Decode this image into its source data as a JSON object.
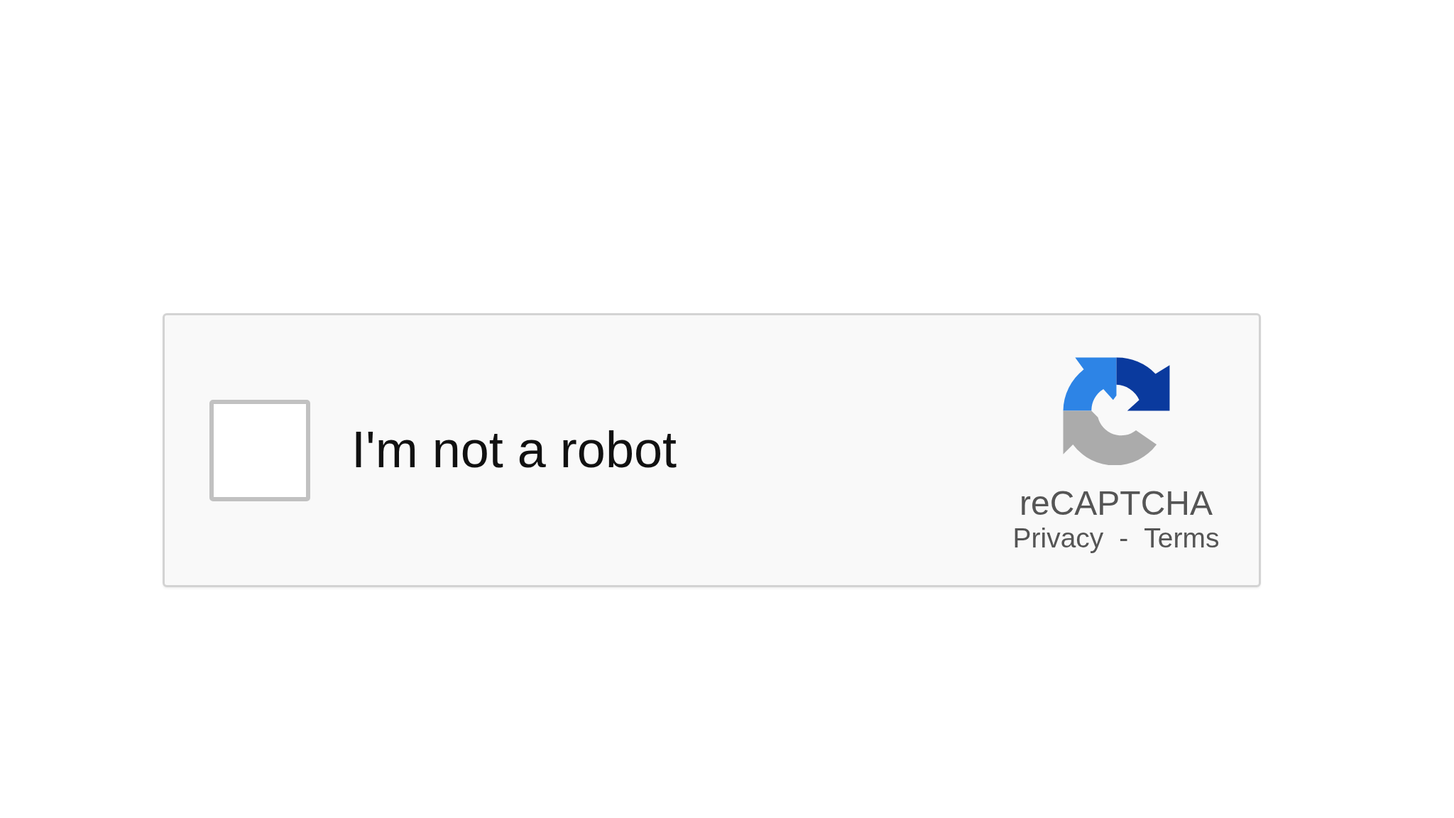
{
  "checkbox": {
    "label": "I'm not a robot",
    "checked": false
  },
  "brand": {
    "name": "reCAPTCHA",
    "links": [
      "Privacy",
      "Terms"
    ],
    "separator": "-"
  }
}
